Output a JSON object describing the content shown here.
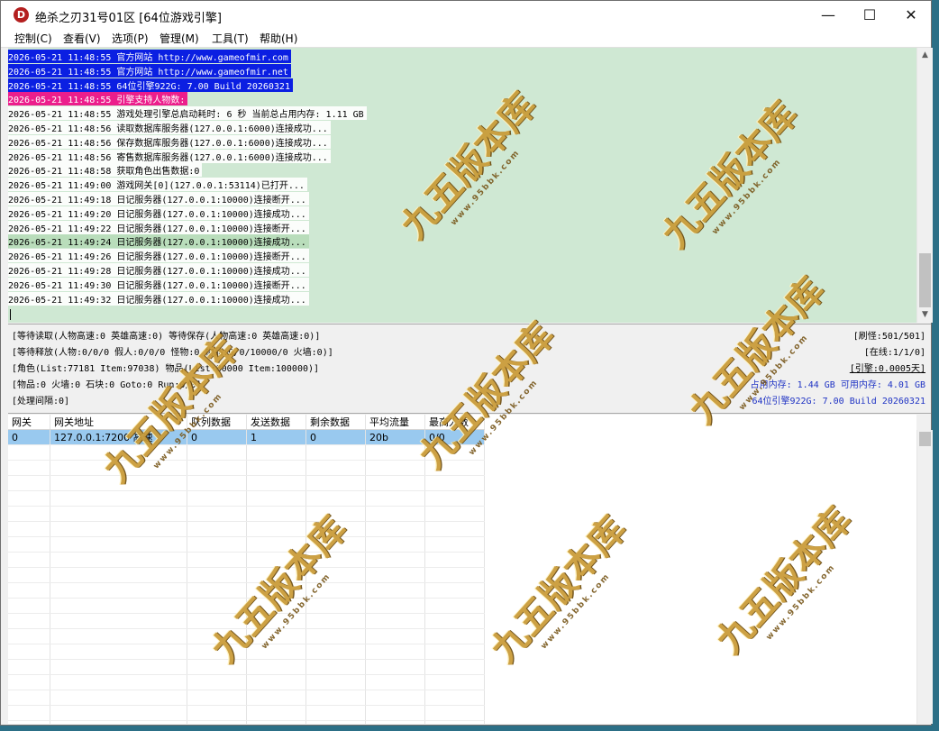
{
  "window": {
    "title": "绝杀之刃31号01区 [64位游戏引擎]",
    "icon_letter": "D",
    "buttons": {
      "minimize": "—",
      "maximize": "☐",
      "close": "✕"
    }
  },
  "menu": [
    "控制(C)",
    "查看(V)",
    "选项(P)",
    "管理(M)",
    "工具(T)",
    "帮助(H)"
  ],
  "log": [
    {
      "text": "2026-05-21 11:48:55 官方网站 http://www.gameofmir.com",
      "style": "blue"
    },
    {
      "text": "2026-05-21 11:48:55 官方网站 http://www.gameofmir.net",
      "style": "blue"
    },
    {
      "text": "2026-05-21 11:48:55 64位引擎922G: 7.00 Build 20260321",
      "style": "blue"
    },
    {
      "text": "2026-05-21 11:48:55 引擎支持人物数:",
      "style": "pink"
    },
    {
      "text": "2026-05-21 11:48:55 游戏处理引擎总启动耗时: 6 秒 当前总占用内存: 1.11 GB",
      "style": "white"
    },
    {
      "text": "2026-05-21 11:48:56 读取数据库服务器(127.0.0.1:6000)连接成功...",
      "style": "white"
    },
    {
      "text": "2026-05-21 11:48:56 保存数据库服务器(127.0.0.1:6000)连接成功...",
      "style": "white"
    },
    {
      "text": "2026-05-21 11:48:56 寄售数据库服务器(127.0.0.1:6000)连接成功...",
      "style": "white"
    },
    {
      "text": "2026-05-21 11:48:58 获取角色出售数据:0",
      "style": "white"
    },
    {
      "text": "2026-05-21 11:49:00 游戏网关[0](127.0.0.1:53114)已打开...",
      "style": "white"
    },
    {
      "text": "2026-05-21 11:49:18 日记服务器(127.0.0.1:10000)连接断开...",
      "style": "white"
    },
    {
      "text": "2026-05-21 11:49:20 日记服务器(127.0.0.1:10000)连接成功...",
      "style": "white"
    },
    {
      "text": "2026-05-21 11:49:22 日记服务器(127.0.0.1:10000)连接断开...",
      "style": "white"
    },
    {
      "text": "2026-05-21 11:49:24 日记服务器(127.0.0.1:10000)连接成功...",
      "style": "green"
    },
    {
      "text": "2026-05-21 11:49:26 日记服务器(127.0.0.1:10000)连接断开...",
      "style": "white"
    },
    {
      "text": "2026-05-21 11:49:28 日记服务器(127.0.0.1:10000)连接成功...",
      "style": "white"
    },
    {
      "text": "2026-05-21 11:49:30 日记服务器(127.0.0.1:10000)连接断开...",
      "style": "white"
    },
    {
      "text": "2026-05-21 11:49:32 日记服务器(127.0.0.1:10000)连接成功...",
      "style": "white"
    }
  ],
  "status": {
    "line1": "[等待读取(人物高速:0 英雄高速:0) 等待保存(人物高速:0 英雄高速:0)]",
    "line2": "[等待释放(人物:0/0/0 假人:0/0/0 怪物:0 物品:0/0/10000/0 火墙:0)]",
    "line3": "[角色(List:77181 Item:97038) 物品(List:80000 Item:100000)]",
    "line4": "[物品:0 火墙:0 石块:0 Goto:0 Run:0/0]",
    "line5": "[处理间隔:0]",
    "right1": "[刷怪:501/501]",
    "right2": "[在线:1/1/0]",
    "right3": "[引擎:0.0005天]",
    "right4": "占用内存: 1.44 GB 可用内存: 4.01 GB",
    "right5": "64位引擎922G: 7.00 Build 20260321"
  },
  "gateway_table": {
    "headers": [
      "网关",
      "网关地址",
      "队列数据",
      "发送数据",
      "剩余数据",
      "平均流量",
      "最高人数"
    ],
    "rows": [
      [
        "0",
        "127.0.0.1:7200 高速",
        "0",
        "1",
        "0",
        "20b",
        "0/0"
      ]
    ]
  },
  "watermark": {
    "text": "九五版本库",
    "sub": "www.95bbk.com"
  },
  "colors": {
    "log_bg": "#cfe8d3",
    "highlight_blue": "#0b1fe2",
    "highlight_pink": "#ec1e8c",
    "row_selected": "#99c9ef"
  }
}
